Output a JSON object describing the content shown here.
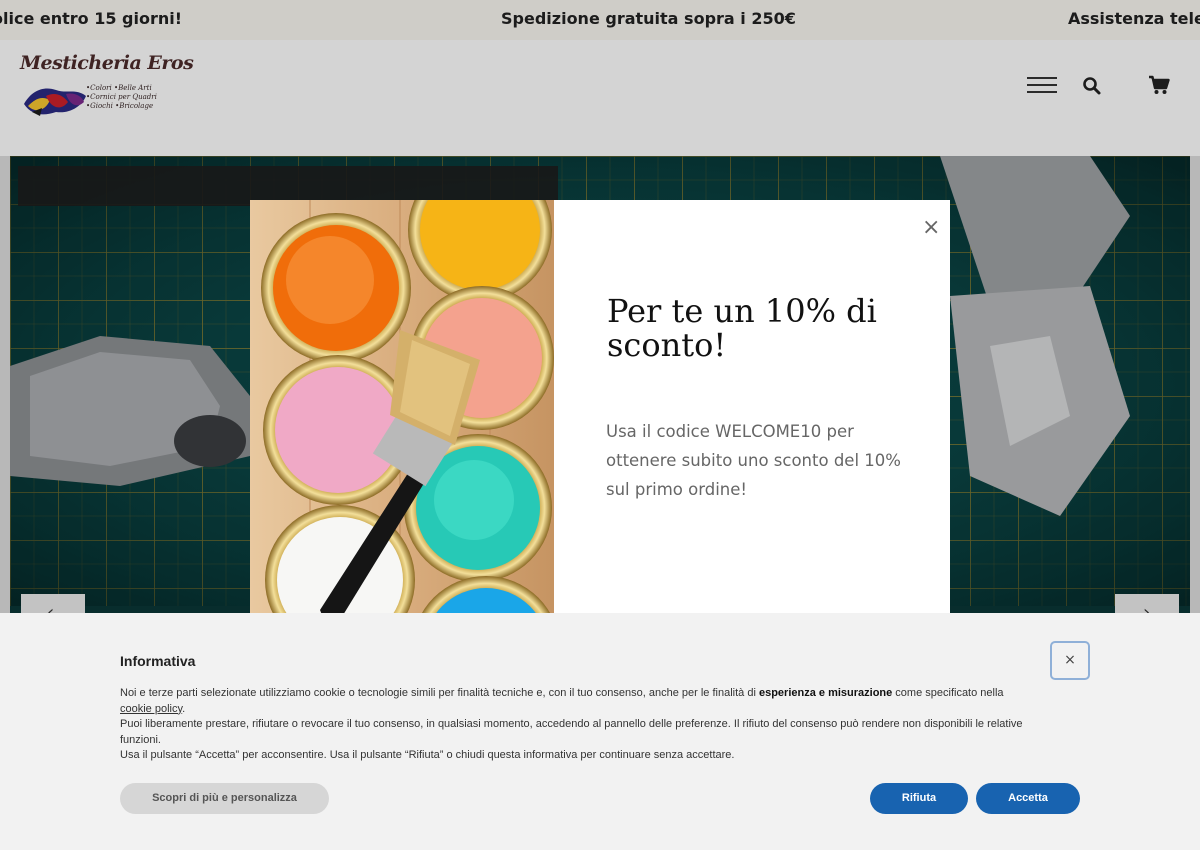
{
  "announcement": {
    "item1": "olice entro 15 giorni!",
    "item2": "Spedizione gratuita sopra i 250€",
    "item3": "Assistenza telefo"
  },
  "header": {
    "logo_title": "Mesticheria Eros",
    "logo_line1": "•Colori  •Belle Arti",
    "logo_line2": "•Cornici per Quadri",
    "logo_line3": "•Giochi  •Bricolage"
  },
  "hero": {
    "prev_arrow": "‹",
    "next_arrow": "›"
  },
  "popup": {
    "close": "×",
    "title": "Per te un 10% di sconto!",
    "text": "Usa il codice WELCOME10 per ottenere subito uno sconto del 10% sul primo ordine!"
  },
  "cookie": {
    "title": "Informativa",
    "p1_start": "Noi e terze parti selezionate utilizziamo cookie o tecnologie simili per finalità tecniche e, con il tuo consenso, anche per le finalità di ",
    "p1_bold": "esperienza e misurazione",
    "p1_end": " come specificato nella ",
    "p1_link": "cookie policy",
    "p1_dot": ".",
    "p2": "Puoi liberamente prestare, rifiutare o revocare il tuo consenso, in qualsiasi momento, accedendo al pannello delle preferenze. Il rifiuto del consenso può rendere non disponibili le relative funzioni.",
    "p3": "Usa il pulsante “Accetta” per acconsentire. Usa il pulsante “Rifiuta” o chiudi questa informativa per continuare senza accettare.",
    "close": "×",
    "btn_more": "Scopri di più e personalizza",
    "btn_reject": "Rifiuta",
    "btn_accept": "Accetta"
  },
  "colors": {
    "accent": "#1863b0",
    "announcement_bg": "#f4f1ec",
    "hero_bg": "#0b3b3c"
  }
}
